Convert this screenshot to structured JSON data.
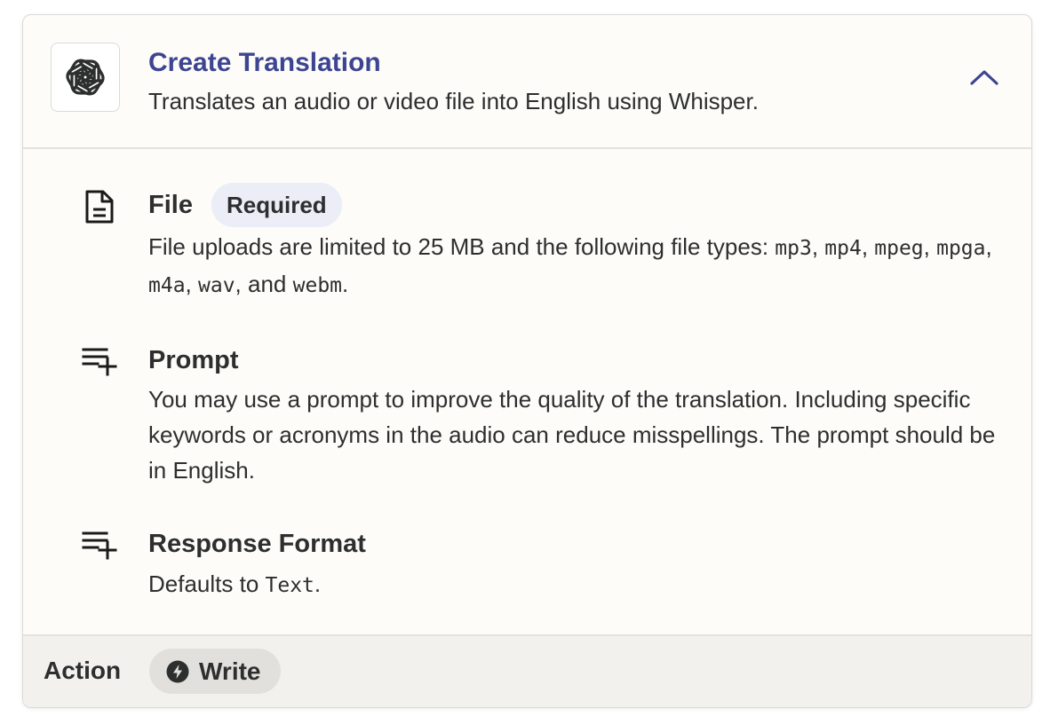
{
  "header": {
    "title": "Create Translation",
    "description": "Translates an audio or video file into English using Whisper.",
    "logo_icon": "openai-logo-icon",
    "collapse_icon": "chevron-up-icon",
    "accent_color": "#3d4592"
  },
  "fields": [
    {
      "icon": "document-icon",
      "title": "File",
      "badge": "Required",
      "description_parts": {
        "intro": "File uploads are limited to 25 MB and the following file types: ",
        "type_mp3": "mp3",
        "type_mp4": "mp4",
        "type_mpeg": "mpeg",
        "type_mpga": "mpga",
        "type_m4a": "m4a",
        "type_wav": "wav",
        "conj": "and",
        "type_webm": "webm"
      }
    },
    {
      "icon": "list-add-icon",
      "title": "Prompt",
      "description": "You may use a prompt to improve the quality of the translation. Including specific keywords or acronyms in the audio can reduce misspellings. The prompt should be in English."
    },
    {
      "icon": "list-add-icon",
      "title": "Response Format",
      "description_prefix": "Defaults to ",
      "description_code": "Text",
      "description_suffix": "."
    }
  ],
  "footer": {
    "label": "Action",
    "pill_icon": "bolt-icon",
    "pill_label": "Write"
  }
}
